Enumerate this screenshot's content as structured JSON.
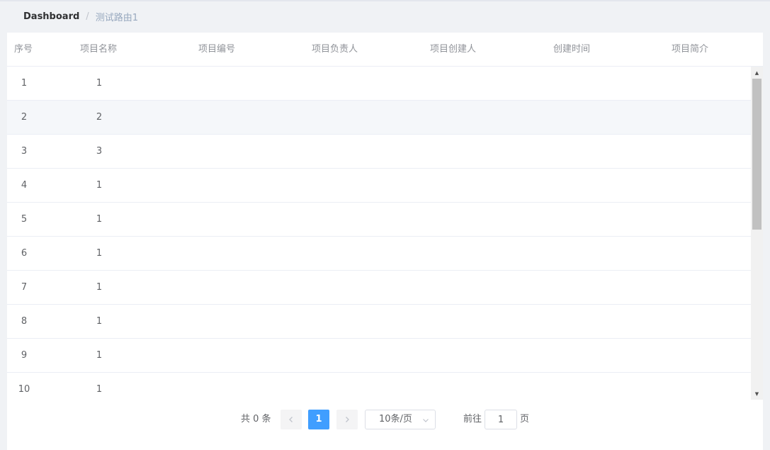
{
  "breadcrumb": {
    "home": "Dashboard",
    "separator": "/",
    "current": "测试路由1"
  },
  "table": {
    "columns": [
      "序号",
      "项目名称",
      "项目编号",
      "项目负责人",
      "项目创建人",
      "创建时间",
      "项目简介"
    ],
    "rows": [
      {
        "index": "1",
        "name": "1"
      },
      {
        "index": "2",
        "name": "2"
      },
      {
        "index": "3",
        "name": "3"
      },
      {
        "index": "4",
        "name": "1"
      },
      {
        "index": "5",
        "name": "1"
      },
      {
        "index": "6",
        "name": "1"
      },
      {
        "index": "7",
        "name": "1"
      },
      {
        "index": "8",
        "name": "1"
      },
      {
        "index": "9",
        "name": "1"
      },
      {
        "index": "10",
        "name": "1"
      }
    ],
    "hovered_row": 1
  },
  "pagination": {
    "total_label": "共 0 条",
    "current_page": "1",
    "page_size": "10条/页",
    "goto_label": "前往",
    "goto_value": "1",
    "goto_suffix": "页"
  },
  "colors": {
    "accent": "#409eff",
    "row_hover": "#f5f7fa",
    "page_background": "#f0f2f5"
  }
}
